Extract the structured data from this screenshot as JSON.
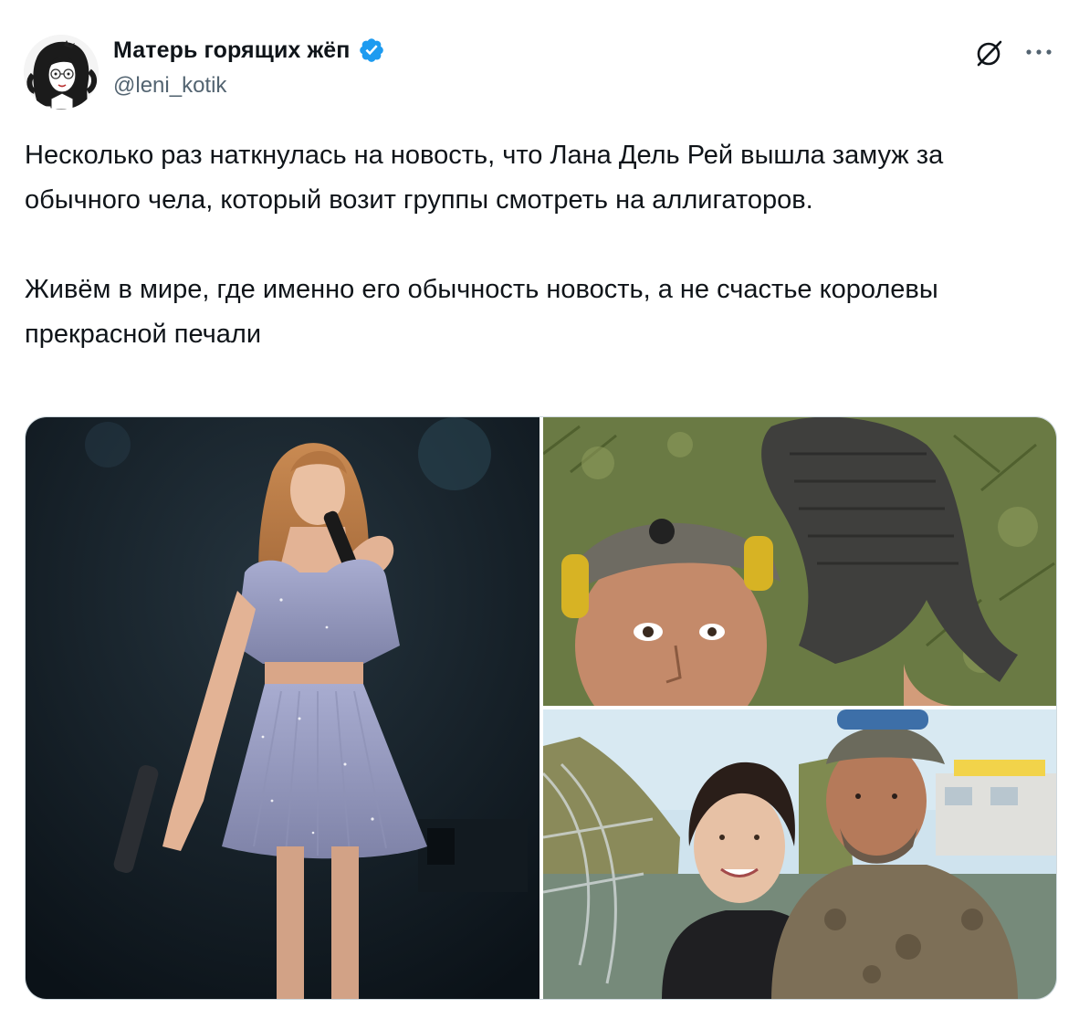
{
  "author": {
    "display_name": "Матерь горящих жёп",
    "handle": "@leni_kotik",
    "verified": true,
    "avatar_icon": "avatar-illustration",
    "verified_color": "#1d9bf0"
  },
  "actions": {
    "grok_icon": "grok-slash-circle-icon",
    "more_icon": "more-horizontal-icon"
  },
  "tweet": {
    "paragraph_1": "Несколько раз наткнулась на новость, что Лана Дель Рей вышла замуж за обычного чела, который возит группы смотреть на аллигаторов.",
    "paragraph_2": "Живём в мире, где именно его обычность новость, а не счастье королевы прекрасной печали"
  },
  "media": [
    {
      "name": "photo-singer-on-stage"
    },
    {
      "name": "photo-man-with-alligator"
    },
    {
      "name": "photo-couple-outdoors"
    }
  ],
  "colors": {
    "text_primary": "#0f1419",
    "text_secondary": "#536471",
    "border": "#cfd9de"
  }
}
